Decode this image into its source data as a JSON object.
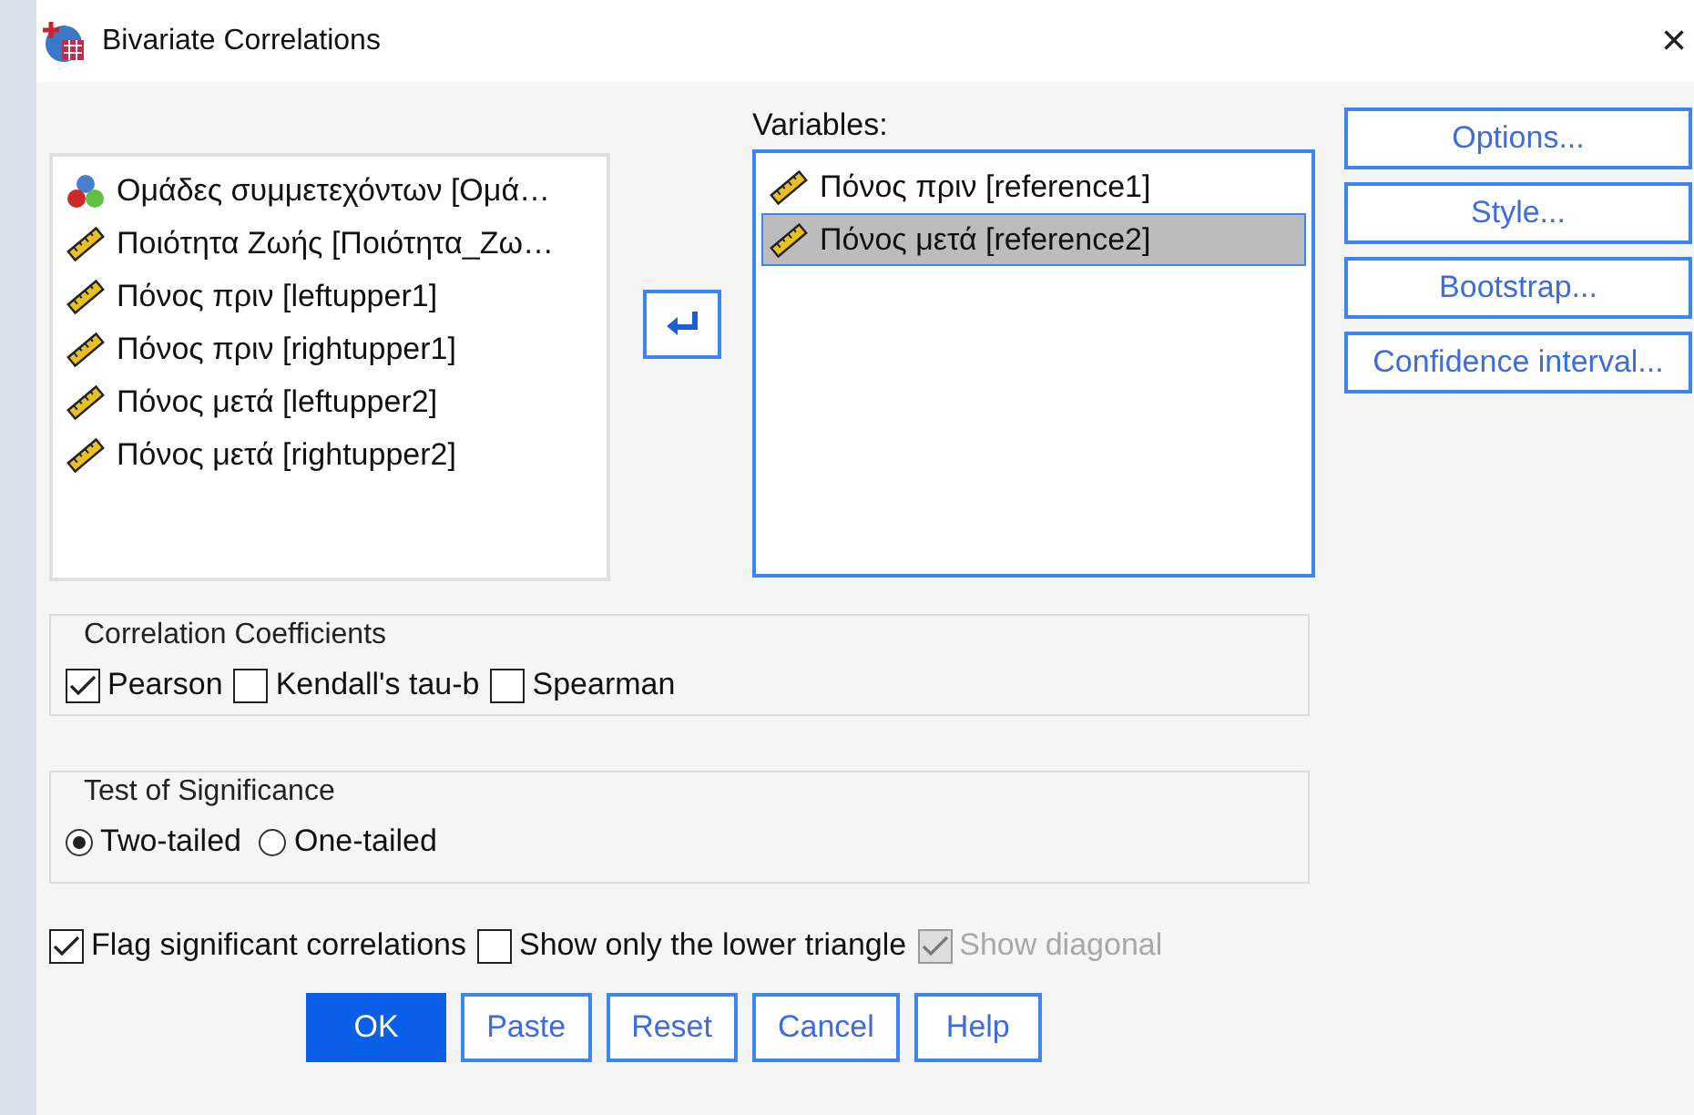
{
  "window": {
    "title": "Bivariate Correlations",
    "close": "×"
  },
  "source_variables": [
    {
      "label": "Ομάδες συμμετεχόντων [Ομά…",
      "kind": "nominal",
      "selected": false
    },
    {
      "label": "Ποιότητα Ζωής [Ποιότητα_Ζω…",
      "kind": "scale",
      "selected": false
    },
    {
      "label": "Πόνος πριν [leftupper1]",
      "kind": "scale",
      "selected": false
    },
    {
      "label": "Πόνος πριν [rightupper1]",
      "kind": "scale",
      "selected": false
    },
    {
      "label": "Πόνος μετά [leftupper2]",
      "kind": "scale",
      "selected": false
    },
    {
      "label": "Πόνος μετά [rightupper2]",
      "kind": "scale",
      "selected": false
    }
  ],
  "variables": {
    "label": "Variables:",
    "items": [
      {
        "label": "Πόνος πριν [reference1]",
        "kind": "scale",
        "selected": false
      },
      {
        "label": "Πόνος μετά [reference2]",
        "kind": "scale",
        "selected": true
      }
    ]
  },
  "side_buttons": [
    "Options...",
    "Style...",
    "Bootstrap...",
    "Confidence interval..."
  ],
  "correlation_coefficients": {
    "title": "Correlation Coefficients",
    "options": [
      {
        "label": "Pearson",
        "checked": true
      },
      {
        "label": "Kendall's tau-b",
        "checked": false
      },
      {
        "label": "Spearman",
        "checked": false
      }
    ]
  },
  "test_of_significance": {
    "title": "Test of Significance",
    "options": [
      {
        "label": "Two-tailed",
        "selected": true
      },
      {
        "label": "One-tailed",
        "selected": false
      }
    ]
  },
  "flags": [
    {
      "label": "Flag significant correlations",
      "checked": true,
      "disabled": false
    },
    {
      "label": "Show only the lower triangle",
      "checked": false,
      "disabled": false
    },
    {
      "label": "Show diagonal",
      "checked": true,
      "disabled": true
    }
  ],
  "buttons": [
    {
      "label": "OK",
      "kind": "default"
    },
    {
      "label": "Paste",
      "kind": "normal"
    },
    {
      "label": "Reset",
      "kind": "normal"
    },
    {
      "label": "Cancel",
      "kind": "normal"
    },
    {
      "label": "Help",
      "kind": "normal"
    }
  ]
}
